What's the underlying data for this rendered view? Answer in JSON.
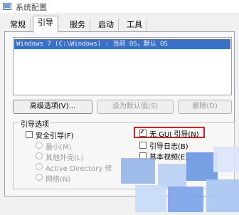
{
  "window": {
    "title": "系统配置"
  },
  "tabs": [
    {
      "label": "常规"
    },
    {
      "label": "引导"
    },
    {
      "label": "服务"
    },
    {
      "label": "启动"
    },
    {
      "label": "工具"
    }
  ],
  "os_list": [
    "Windows 7 (C:\\Windows) : 当前 OS，默认 OS"
  ],
  "buttons": {
    "advanced": "高级选项(V)...",
    "set_default": "设为默认值(S)",
    "delete": "删除(D)"
  },
  "boot_options": {
    "group_label": "引导选项",
    "safe_boot": "安全引导(F)",
    "minimal": "最小(M)",
    "alternate_shell": "其他外壳(L)",
    "active_directory": "Active Directory 修",
    "network": "网络(N)",
    "no_gui": "无 GUI 引导(N)",
    "boot_log": "引导日志(B)",
    "base_video": "基本视频(E)"
  },
  "colors": {
    "selection": "#3a6fc4",
    "highlight_box": "#cc2222",
    "watermark_tiles": [
      "#8fb0e8",
      "#b7cdf3",
      "#5f8fe0",
      "#c9dbf7",
      "#7aa2ea",
      "#a9c4f2"
    ]
  }
}
